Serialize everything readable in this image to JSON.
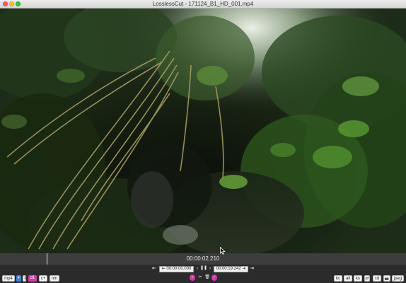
{
  "window": {
    "title": "LosslessCut - 171124_B1_HD_001.mp4"
  },
  "timeline": {
    "current_time": "00:00:02.210",
    "progress_fraction": 0.115
  },
  "controls": {
    "cut_start_time": "00:00:00.000",
    "cut_end_time": "00:00:19.242",
    "format": "mp4",
    "left_buttons": [
      "d1",
      "c+",
      "nm"
    ],
    "right_buttons": [
      "kc",
      "all",
      "ks",
      "cd",
      "jpeg"
    ],
    "glyphs": {
      "jump_start": "⇤",
      "prev": "‹",
      "next": "›",
      "jump_end": "⇥",
      "set_start": "⇤",
      "set_end": "⇥",
      "play": "❚❚",
      "cut": "✂",
      "trash": "🗑",
      "camera": "📷",
      "arrow": "⇄"
    }
  },
  "colors": {
    "accent_pink": "#d23aa6",
    "accent_blue": "#3d7fd9",
    "timeline_bg": "#3d3d3d",
    "controls_bg": "#2b2b2b"
  }
}
